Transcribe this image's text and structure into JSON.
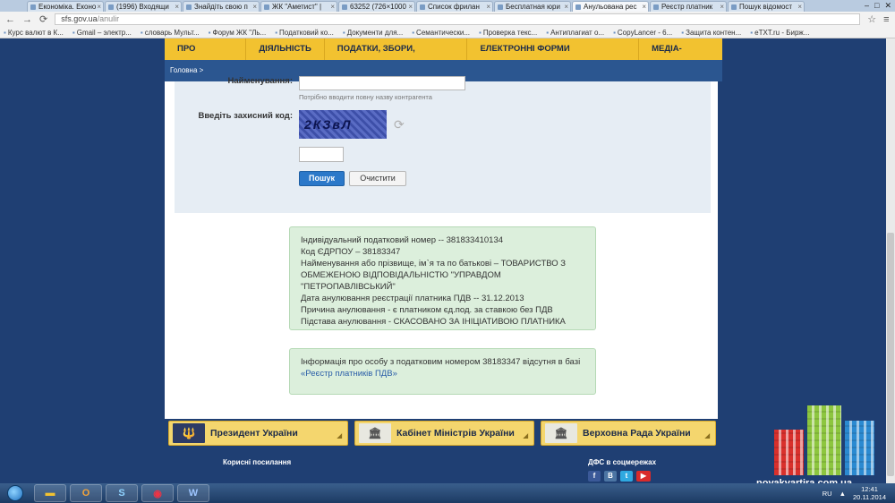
{
  "browser": {
    "tabs": [
      {
        "label": "Економіка. Еконо",
        "active": false
      },
      {
        "label": "(1996) Входящи",
        "active": false
      },
      {
        "label": "Знайдіть свою п",
        "active": false
      },
      {
        "label": "ЖК \"Аметист\" |",
        "active": false
      },
      {
        "label": "63252 (726×1000",
        "active": false
      },
      {
        "label": "Список фрилан",
        "active": false
      },
      {
        "label": "Бесплатная юри",
        "active": false
      },
      {
        "label": "Анульована рес",
        "active": true
      },
      {
        "label": "Реєстр платник",
        "active": false
      },
      {
        "label": "Пошук відомост",
        "active": false
      }
    ],
    "url_host": "sfs.gov.ua",
    "url_path": "/anulir",
    "bookmarks": [
      "Курс валют в К...",
      "Gmail – электр...",
      "словарь Мульт...",
      "Форум ЖК \"Ль...",
      "Податковий ко...",
      "Документи для...",
      "Семантически...",
      "Проверка текс...",
      "Антиплагиат о...",
      "CopyLancer - 6...",
      "Защита контен...",
      "eTXT.ru - Бирж..."
    ]
  },
  "nav": {
    "items": [
      "ПРО СЛУЖБУ",
      "ДІЯЛЬНІСТЬ",
      "ПОДАТКИ, ЗБОРИ, ПЛАТЕЖІ",
      "ЕЛЕКТРОННІ ФОРМИ ДОКУМЕНТІВ",
      "МЕДІА-ЦЕНТР"
    ]
  },
  "breadcrumb": {
    "home": "Головна",
    "sep": ">"
  },
  "form": {
    "name_label": "Найменування:",
    "name_hint": "Потрібно вводити повну назву контрагента",
    "captcha_label": "Введіть захисний код:",
    "captcha_text": "2КЗвЛ",
    "search_button": "Пошук",
    "clear_button": "Очистити"
  },
  "result": {
    "lines": [
      "Індивідуальний податковий номер -- 381833410134",
      "Код ЄДРПОУ – 38183347",
      "Найменування або прізвище, ім`я та по батькові – ТОВАРИСТВО З ОБМЕЖЕНОЮ ВІДПОВІДАЛЬНІСТЮ \"УПРАВДОМ \"ПЕТРОПАВЛІВСЬКИЙ\"",
      "Дата анулювання реєстрації платника ПДВ -- 31.12.2013",
      "Причина анулювання - є платником єд.под. за ставкою без ПДВ",
      "Підстава анулювання - СКАСОВАНО ЗА ІНІЦІАТИВОЮ ПЛАТНИКА"
    ]
  },
  "notice": {
    "text": "Інформація про особу з податковим номером 38183347 відсутня в базі",
    "link": "«Реєстр платників ПДВ»"
  },
  "footer": {
    "president": "Президент України",
    "cabinet": "Кабінет Міністрів України",
    "rada": "Верховна Рада України",
    "useful_links": "Корисні посилання",
    "social_title": "ДФС в соцмережах"
  },
  "watermark": {
    "text": "novakvartira.com.ua"
  },
  "taskbar": {
    "apps": [
      "",
      "O",
      "S",
      "",
      "W"
    ],
    "lang": "RU",
    "date": "20.11.2014",
    "time": "12:41"
  },
  "colors": {
    "nav": "#f2c230",
    "primary": "#2b78c9",
    "success_bg": "#dcefdc"
  }
}
